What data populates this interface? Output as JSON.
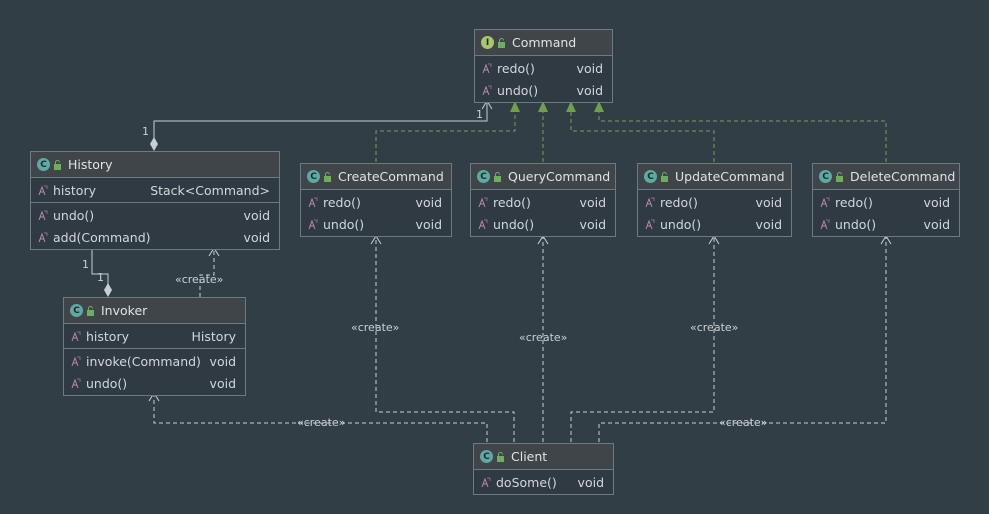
{
  "classes": {
    "command": {
      "kind": "I",
      "name": "Command",
      "methods": [
        {
          "name": "redo()",
          "type": "void"
        },
        {
          "name": "undo()",
          "type": "void"
        }
      ]
    },
    "history": {
      "kind": "C",
      "name": "History",
      "fields": [
        {
          "name": "history",
          "type": "Stack<Command>"
        }
      ],
      "methods": [
        {
          "name": "undo()",
          "type": "void"
        },
        {
          "name": "add(Command)",
          "type": "void"
        }
      ]
    },
    "invoker": {
      "kind": "C",
      "name": "Invoker",
      "fields": [
        {
          "name": "history",
          "type": "History"
        }
      ],
      "methods": [
        {
          "name": "invoke(Command)",
          "type": "void"
        },
        {
          "name": "undo()",
          "type": "void"
        }
      ]
    },
    "create_command": {
      "kind": "C",
      "name": "CreateCommand",
      "methods": [
        {
          "name": "redo()",
          "type": "void"
        },
        {
          "name": "undo()",
          "type": "void"
        }
      ]
    },
    "query_command": {
      "kind": "C",
      "name": "QueryCommand",
      "methods": [
        {
          "name": "redo()",
          "type": "void"
        },
        {
          "name": "undo()",
          "type": "void"
        }
      ]
    },
    "update_command": {
      "kind": "C",
      "name": "UpdateCommand",
      "methods": [
        {
          "name": "redo()",
          "type": "void"
        },
        {
          "name": "undo()",
          "type": "void"
        }
      ]
    },
    "delete_command": {
      "kind": "C",
      "name": "DeleteCommand",
      "methods": [
        {
          "name": "redo()",
          "type": "void"
        },
        {
          "name": "undo()",
          "type": "void"
        }
      ]
    },
    "client": {
      "kind": "C",
      "name": "Client",
      "methods": [
        {
          "name": "doSome()",
          "type": "void"
        }
      ]
    }
  },
  "labels": {
    "create": "«create»",
    "mult_one": "1"
  },
  "colors": {
    "background": "#323e46",
    "header": "#3f4549",
    "border": "#6f7a80",
    "edge": "#c8ced1",
    "realization": "#7e9a5c",
    "class_badge": "#5fa9a3",
    "interface_badge": "#a6c76e"
  }
}
